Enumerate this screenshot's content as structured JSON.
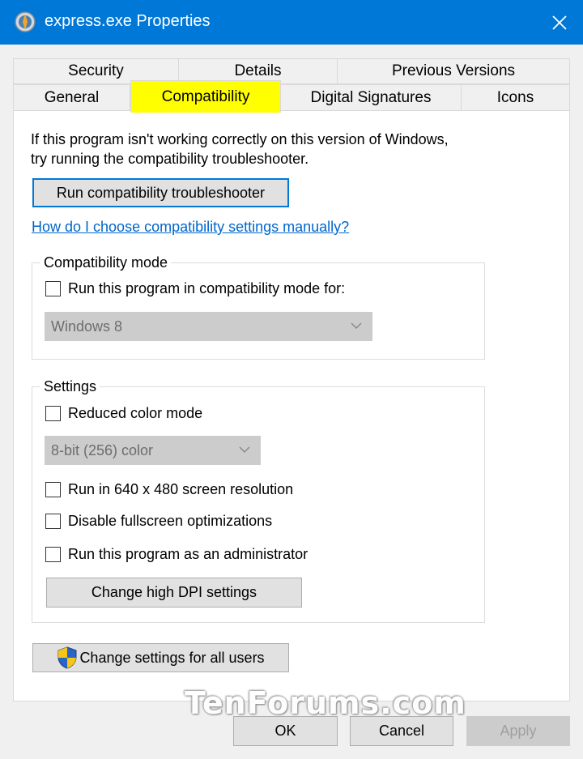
{
  "window": {
    "title": "express.exe Properties"
  },
  "tabs": {
    "row1": [
      {
        "label": "Security"
      },
      {
        "label": "Details"
      },
      {
        "label": "Previous Versions"
      }
    ],
    "row2": [
      {
        "label": "General"
      },
      {
        "label": "Compatibility",
        "active": true
      },
      {
        "label": "Digital Signatures"
      },
      {
        "label": "Icons"
      }
    ]
  },
  "compat": {
    "intro_line1": "If this program isn't working correctly on this version of Windows,",
    "intro_line2": "try running the compatibility troubleshooter.",
    "troubleshooter_button": "Run compatibility troubleshooter",
    "manual_link": "How do I choose compatibility settings manually?",
    "mode_group": {
      "label": "Compatibility mode",
      "checkbox": "Run this program in compatibility mode for:",
      "select_value": "Windows 8"
    },
    "settings_group": {
      "label": "Settings",
      "reduced_color": "Reduced color mode",
      "color_select_value": "8-bit (256) color",
      "res_640": "Run in 640 x 480 screen resolution",
      "disable_fullscreen": "Disable fullscreen optimizations",
      "run_admin": "Run this program as an administrator",
      "dpi_button": "Change high DPI settings"
    },
    "all_users_button": "Change settings for all users"
  },
  "footer": {
    "ok": "OK",
    "cancel": "Cancel",
    "apply": "Apply"
  },
  "watermark": "TenForums.com",
  "colors": {
    "titlebar": "#0078d7",
    "active_tab_highlight": "#ffff00",
    "link": "#0066cc"
  }
}
